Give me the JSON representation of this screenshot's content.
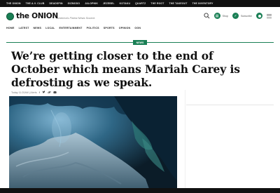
{
  "topbar": {
    "links": [
      "THE ONION",
      "THE A.V. CLUB",
      "DEADSPIN",
      "GIZMODO",
      "JALOPNIK",
      "JEZEBEL",
      "KOTAKU",
      "QUARTZ",
      "THE ROOT",
      "THE TAKEOUT",
      "THE INVENTORY"
    ]
  },
  "header": {
    "logo_text": "the ONION",
    "tagline": "America's Finest News Source.",
    "shop_label": "Shop",
    "subscribe_label": "Subscribe"
  },
  "nav": {
    "items": [
      "HOME",
      "LATEST",
      "NEWS",
      "LOCAL",
      "ENTERTAINMENT",
      "POLITICS",
      "SPORTS",
      "OPINION",
      "OGN"
    ]
  },
  "article": {
    "section_badge": "NEWS",
    "headline": "We’re getting closer to the end of October which means Mariah Carey is defrosting as we speak.",
    "timestamp": "Today 11:20AM | Alerts"
  },
  "colors": {
    "brand_green": "#1a7f55",
    "topbar": "#111111"
  },
  "icons": [
    "search-icon",
    "shop-icon",
    "subscribe-icon",
    "user-icon",
    "menu-icon",
    "facebook-icon",
    "twitter-icon",
    "link-icon",
    "email-icon"
  ]
}
